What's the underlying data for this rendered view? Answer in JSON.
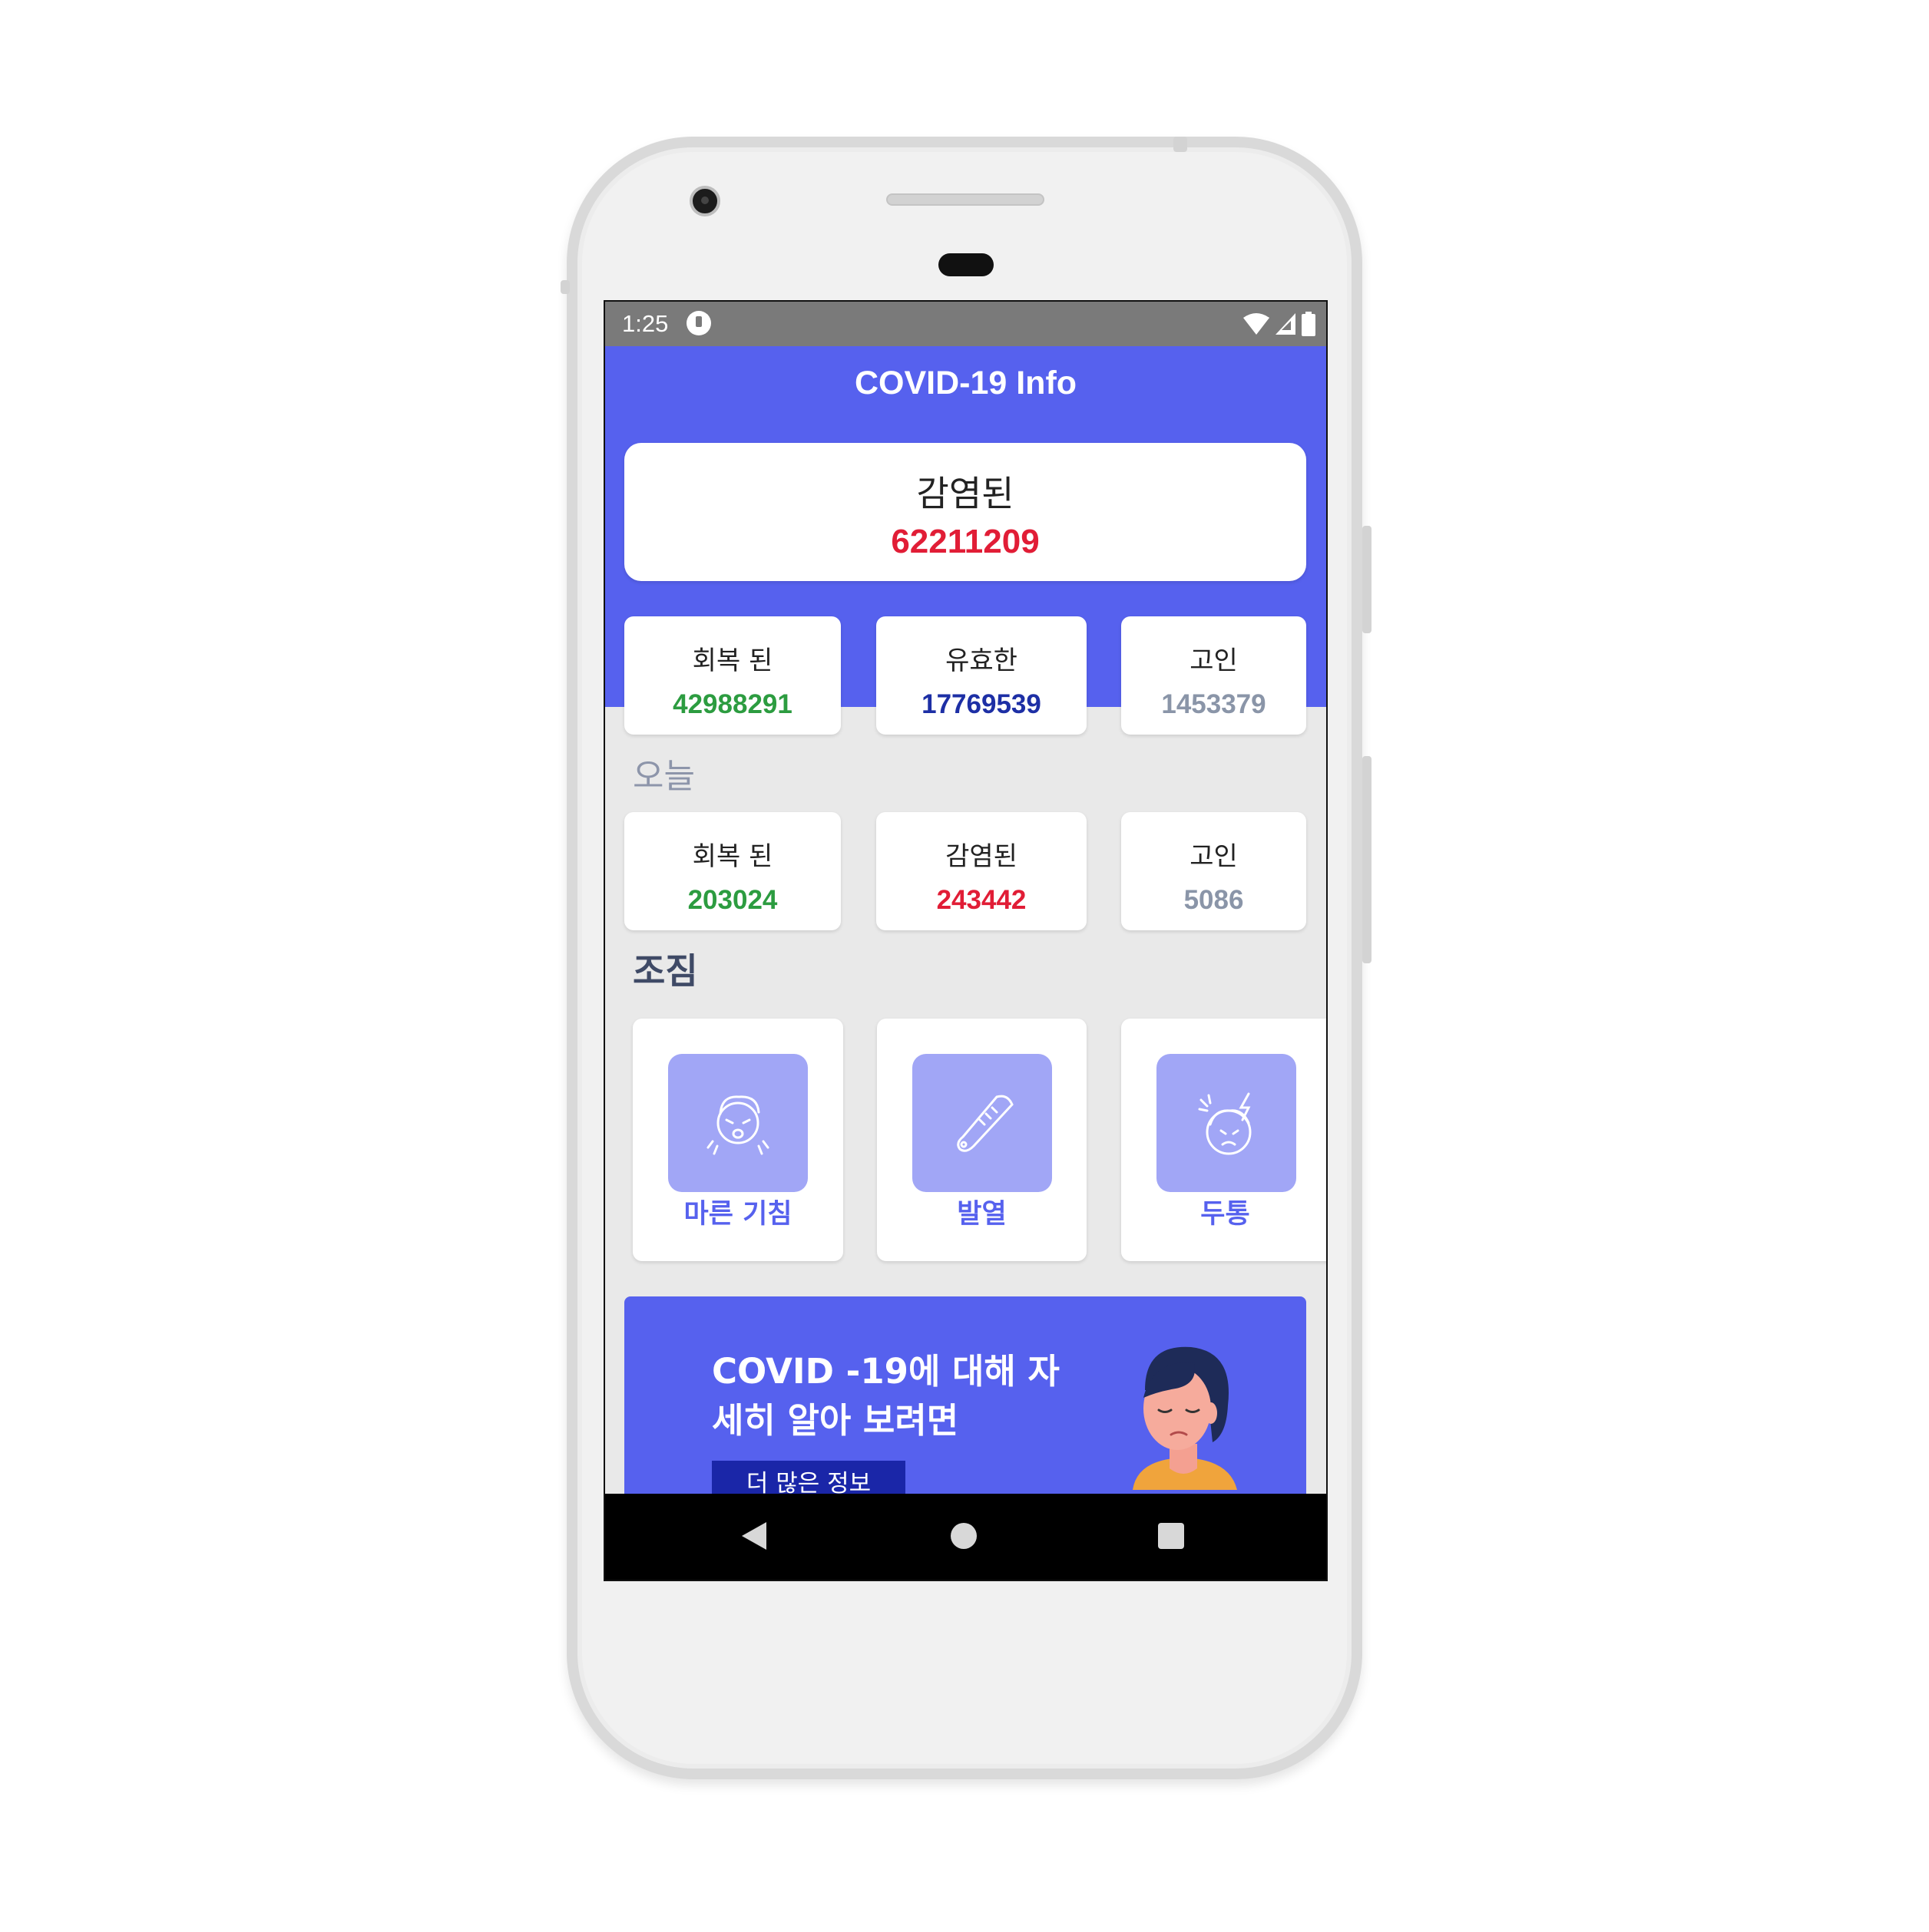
{
  "status_bar": {
    "time": "1:25"
  },
  "app": {
    "title": "COVID-19 Info"
  },
  "total": {
    "label": "감염된",
    "value": "62211209"
  },
  "totals": [
    {
      "label": "회복 된",
      "value": "42988291"
    },
    {
      "label": "유효한",
      "value": "17769539"
    },
    {
      "label": "고인",
      "value": "1453379"
    }
  ],
  "today": {
    "heading": "오늘",
    "stats": [
      {
        "label": "회복 된",
        "value": "203024"
      },
      {
        "label": "감염된",
        "value": "243442"
      },
      {
        "label": "고인",
        "value": "5086"
      }
    ]
  },
  "symptoms": {
    "heading": "조짐",
    "items": [
      {
        "label": "마른 기침",
        "icon": "cough-icon"
      },
      {
        "label": "발열",
        "icon": "thermometer-icon"
      },
      {
        "label": "두통",
        "icon": "headache-icon"
      }
    ]
  },
  "banner": {
    "text": "COVID -19에 대해 자세히 알아 보려면",
    "button_label": "더 많은 정보"
  },
  "colors": {
    "primary": "#5661ee",
    "infected": "#e11d36",
    "recovered": "#2c9c40",
    "active": "#1d2fa5",
    "deceased": "#8a95a8"
  }
}
